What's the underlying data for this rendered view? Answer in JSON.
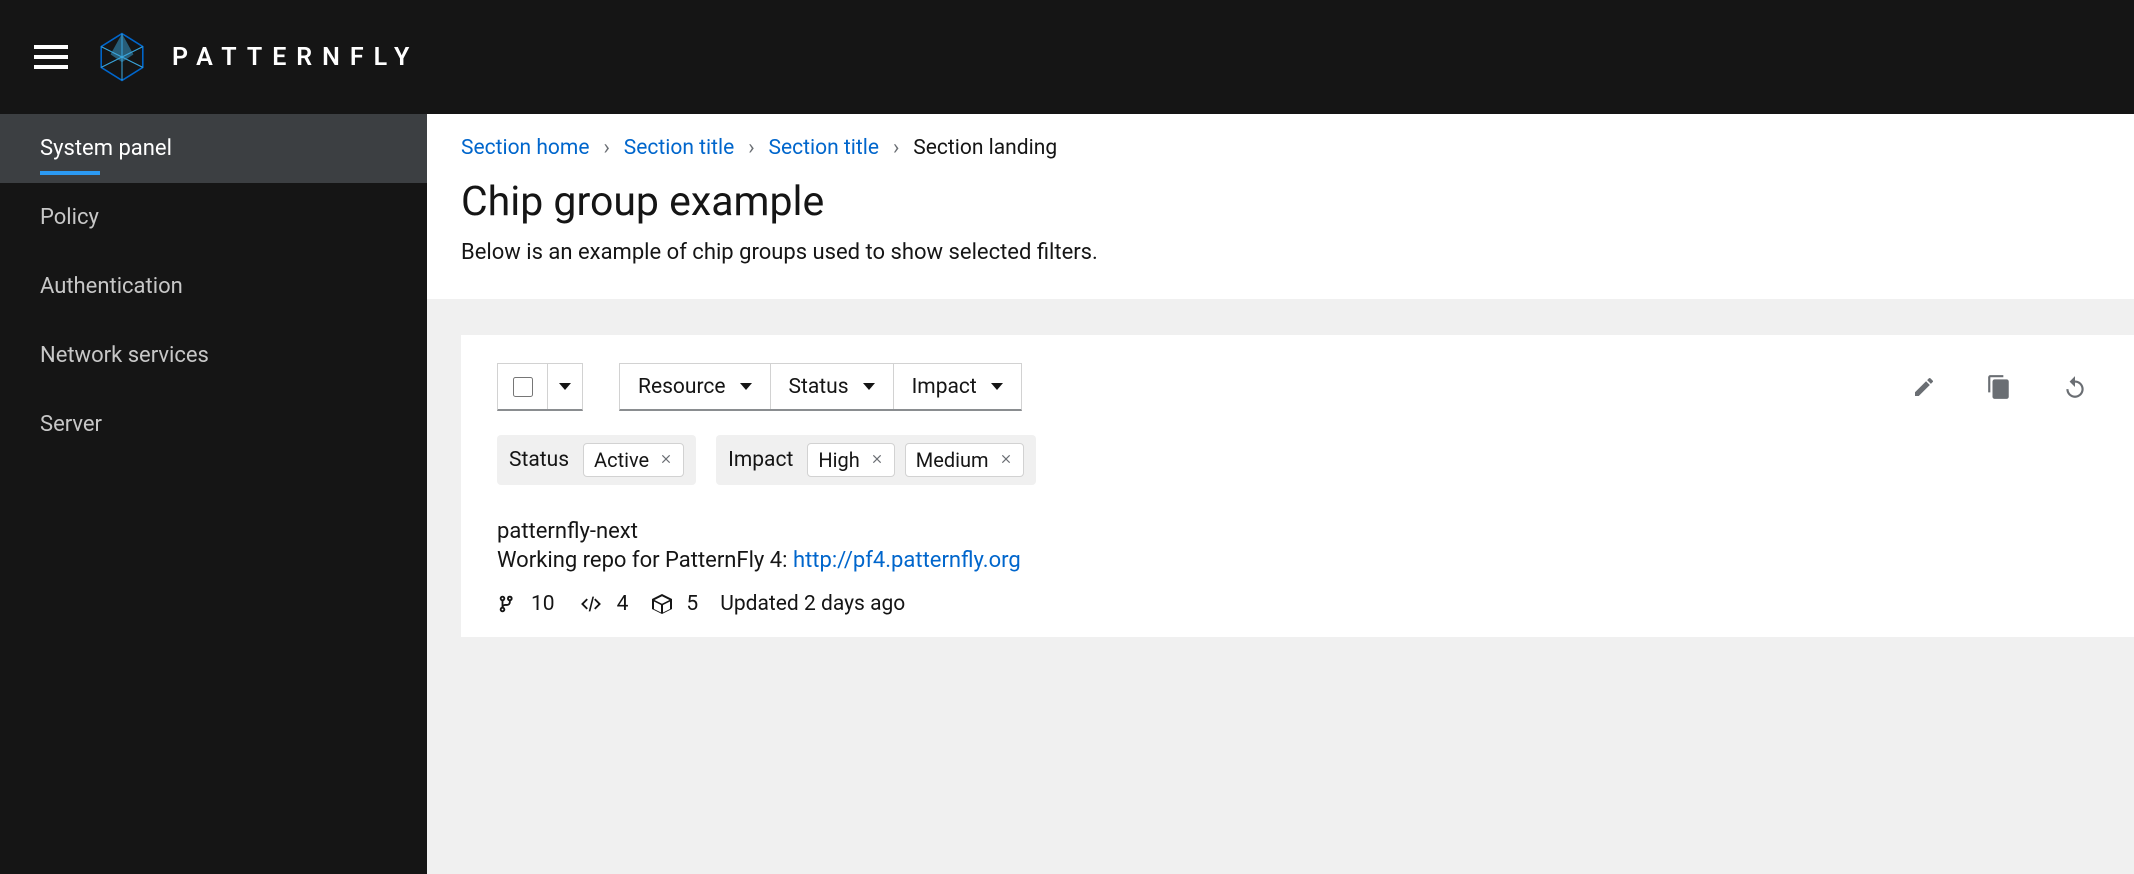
{
  "brand": "PATTERNFLY",
  "sidebar": {
    "items": [
      {
        "label": "System panel",
        "active": true
      },
      {
        "label": "Policy",
        "active": false
      },
      {
        "label": "Authentication",
        "active": false
      },
      {
        "label": "Network services",
        "active": false
      },
      {
        "label": "Server",
        "active": false
      }
    ]
  },
  "breadcrumb": {
    "items": [
      {
        "label": "Section home",
        "link": true
      },
      {
        "label": "Section title",
        "link": true
      },
      {
        "label": "Section title",
        "link": true
      },
      {
        "label": "Section landing",
        "link": false
      }
    ],
    "separator": "›"
  },
  "page": {
    "title": "Chip group example",
    "description": "Below is an example of chip groups used to show selected filters."
  },
  "toolbar": {
    "selects": [
      {
        "label": "Resource"
      },
      {
        "label": "Status"
      },
      {
        "label": "Impact"
      }
    ]
  },
  "chipGroups": [
    {
      "label": "Status",
      "chips": [
        "Active"
      ]
    },
    {
      "label": "Impact",
      "chips": [
        "High",
        "Medium"
      ]
    }
  ],
  "item": {
    "title": "patternfly-next",
    "descPrefix": "Working repo for PatternFly 4: ",
    "linkText": "http://pf4.patternfly.org",
    "meta": {
      "branches": "10",
      "prs": "4",
      "packages": "5",
      "updated": "Updated 2 days ago"
    }
  }
}
